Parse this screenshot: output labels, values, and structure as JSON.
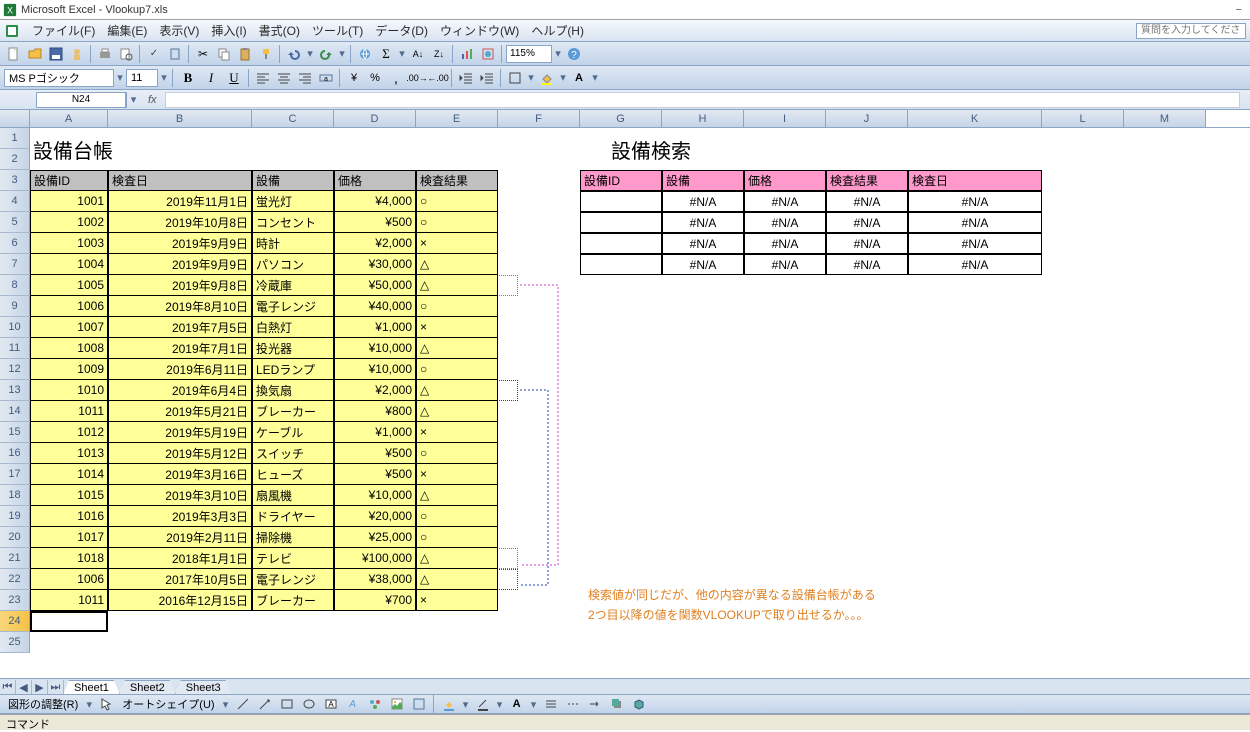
{
  "app": {
    "title": "Microsoft Excel - Vlookup7.xls"
  },
  "menu": {
    "items": [
      "ファイル(F)",
      "編集(E)",
      "表示(V)",
      "挿入(I)",
      "書式(O)",
      "ツール(T)",
      "データ(D)",
      "ウィンドウ(W)",
      "ヘルプ(H)"
    ],
    "help_placeholder": "質問を入力してください"
  },
  "toolbar": {
    "zoom": "115%"
  },
  "format_bar": {
    "font_name": "MS Pゴシック",
    "font_size": "11"
  },
  "namebox": {
    "ref": "N24",
    "fx": "fx"
  },
  "columns": [
    "A",
    "B",
    "C",
    "D",
    "E",
    "F",
    "G",
    "H",
    "I",
    "J",
    "K",
    "L",
    "M"
  ],
  "rows": [
    1,
    2,
    3,
    4,
    5,
    6,
    7,
    8,
    9,
    10,
    11,
    12,
    13,
    14,
    15,
    16,
    17,
    18,
    19,
    20,
    21,
    22,
    23,
    24,
    25
  ],
  "titles": {
    "left": "設備台帳",
    "right": "設備検索"
  },
  "left_headers": [
    "設備ID",
    "検査日",
    "設備",
    "価格",
    "検査結果"
  ],
  "left_rows": [
    {
      "id": "1001",
      "date": "2019年11月1日",
      "equip": "蛍光灯",
      "price": "¥4,000",
      "result": "○"
    },
    {
      "id": "1002",
      "date": "2019年10月8日",
      "equip": "コンセント",
      "price": "¥500",
      "result": "○"
    },
    {
      "id": "1003",
      "date": "2019年9月9日",
      "equip": "時計",
      "price": "¥2,000",
      "result": "×"
    },
    {
      "id": "1004",
      "date": "2019年9月9日",
      "equip": "パソコン",
      "price": "¥30,000",
      "result": "△"
    },
    {
      "id": "1005",
      "date": "2019年9月8日",
      "equip": "冷蔵庫",
      "price": "¥50,000",
      "result": "△"
    },
    {
      "id": "1006",
      "date": "2019年8月10日",
      "equip": "電子レンジ",
      "price": "¥40,000",
      "result": "○"
    },
    {
      "id": "1007",
      "date": "2019年7月5日",
      "equip": "白熱灯",
      "price": "¥1,000",
      "result": "×"
    },
    {
      "id": "1008",
      "date": "2019年7月1日",
      "equip": "投光器",
      "price": "¥10,000",
      "result": "△"
    },
    {
      "id": "1009",
      "date": "2019年6月11日",
      "equip": "LEDランプ",
      "price": "¥10,000",
      "result": "○"
    },
    {
      "id": "1010",
      "date": "2019年6月4日",
      "equip": "換気扇",
      "price": "¥2,000",
      "result": "△"
    },
    {
      "id": "1011",
      "date": "2019年5月21日",
      "equip": "ブレーカー",
      "price": "¥800",
      "result": "△"
    },
    {
      "id": "1012",
      "date": "2019年5月19日",
      "equip": "ケーブル",
      "price": "¥1,000",
      "result": "×"
    },
    {
      "id": "1013",
      "date": "2019年5月12日",
      "equip": "スイッチ",
      "price": "¥500",
      "result": "○"
    },
    {
      "id": "1014",
      "date": "2019年3月16日",
      "equip": "ヒューズ",
      "price": "¥500",
      "result": "×"
    },
    {
      "id": "1015",
      "date": "2019年3月10日",
      "equip": "扇風機",
      "price": "¥10,000",
      "result": "△"
    },
    {
      "id": "1016",
      "date": "2019年3月3日",
      "equip": "ドライヤー",
      "price": "¥20,000",
      "result": "○"
    },
    {
      "id": "1017",
      "date": "2019年2月11日",
      "equip": "掃除機",
      "price": "¥25,000",
      "result": "○"
    },
    {
      "id": "1018",
      "date": "2018年1月1日",
      "equip": "テレビ",
      "price": "¥100,000",
      "result": "△"
    },
    {
      "id": "1006",
      "date": "2017年10月5日",
      "equip": "電子レンジ",
      "price": "¥38,000",
      "result": "△"
    },
    {
      "id": "1011",
      "date": "2016年12月15日",
      "equip": "ブレーカー",
      "price": "¥700",
      "result": "×"
    }
  ],
  "right_headers": [
    "設備ID",
    "設備",
    "価格",
    "検査結果",
    "検査日"
  ],
  "right_rows": [
    {
      "c1": "#N/A",
      "c2": "#N/A",
      "c3": "#N/A",
      "c4": "#N/A"
    },
    {
      "c1": "#N/A",
      "c2": "#N/A",
      "c3": "#N/A",
      "c4": "#N/A"
    },
    {
      "c1": "#N/A",
      "c2": "#N/A",
      "c3": "#N/A",
      "c4": "#N/A"
    },
    {
      "c1": "#N/A",
      "c2": "#N/A",
      "c3": "#N/A",
      "c4": "#N/A"
    }
  ],
  "notes": {
    "line1": "検索値が同じだが、他の内容が異なる設備台帳がある",
    "line2": "2つ目以降の値を関数VLOOKUPで取り出せるか。。。"
  },
  "sheet_tabs": [
    "Sheet1",
    "Sheet2",
    "Sheet3"
  ],
  "draw_bar": {
    "adjust": "図形の調整(R)",
    "autoshape": "オートシェイプ(U)"
  },
  "status": "コマンド",
  "col_widths": {
    "A": 78,
    "B": 144,
    "C": 82,
    "D": 82,
    "E": 82,
    "F": 82,
    "G": 82,
    "H": 82,
    "I": 82,
    "J": 82,
    "K": 134,
    "L": 82,
    "M": 82
  }
}
